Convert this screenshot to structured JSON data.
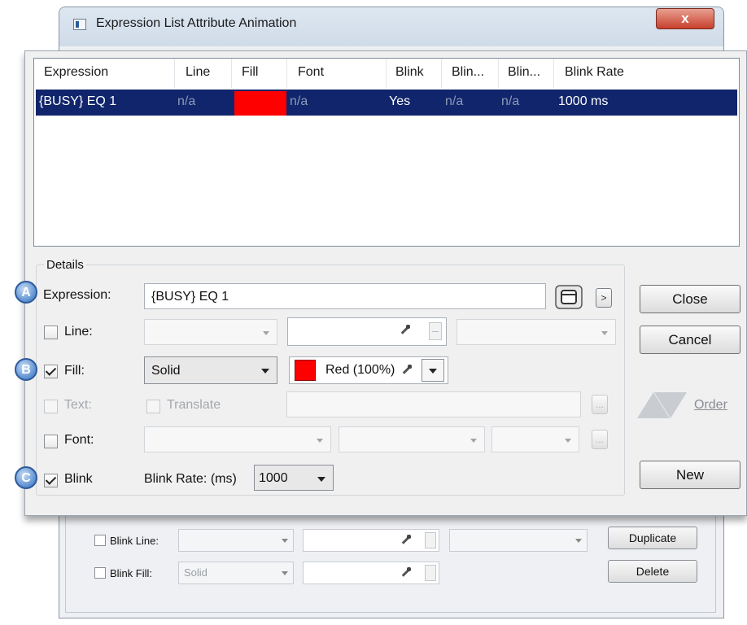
{
  "window": {
    "title": "Expression List Attribute Animation",
    "close_glyph": "x"
  },
  "list": {
    "columns": [
      "Expression",
      "Line",
      "Fill",
      "Font",
      "Blink",
      "Blin...",
      "Blin...",
      "Blink Rate"
    ],
    "rows": [
      {
        "expression": "{BUSY} EQ 1",
        "line": "n/a",
        "fill_color": "#ff0000",
        "font": "n/a",
        "blink": "Yes",
        "blink_line": "n/a",
        "blink_fill": "n/a",
        "blink_rate": "1000 ms"
      }
    ]
  },
  "details": {
    "group_label": "Details",
    "markers": [
      "A",
      "B",
      "C"
    ],
    "expression_label": "Expression:",
    "expression_value": "{BUSY} EQ 1",
    "expression_arrow": ">",
    "line_label": "Line:",
    "fill_label": "Fill:",
    "fill_style": "Solid",
    "fill_color_text": "Red (100%)",
    "text_label": "Text:",
    "translate_label": "Translate",
    "font_label": "Font:",
    "blink_label": "Blink",
    "blink_rate_label": "Blink Rate: (ms)",
    "blink_rate_value": "1000",
    "ellipsis": "...",
    "checks": {
      "line": false,
      "fill": true,
      "text": false,
      "translate": false,
      "font": false,
      "blink": true
    }
  },
  "buttons": {
    "close": "Close",
    "cancel": "Cancel",
    "order": "Order",
    "new": "New",
    "duplicate": "Duplicate",
    "delete": "Delete"
  },
  "background_form": {
    "blink_line_label": "Blink Line:",
    "blink_fill_label": "Blink Fill:",
    "blink_fill_style": "Solid"
  },
  "colors": {
    "selection": "#10256b",
    "fill_red": "#ff0000",
    "marker": "#5a8ed0"
  }
}
